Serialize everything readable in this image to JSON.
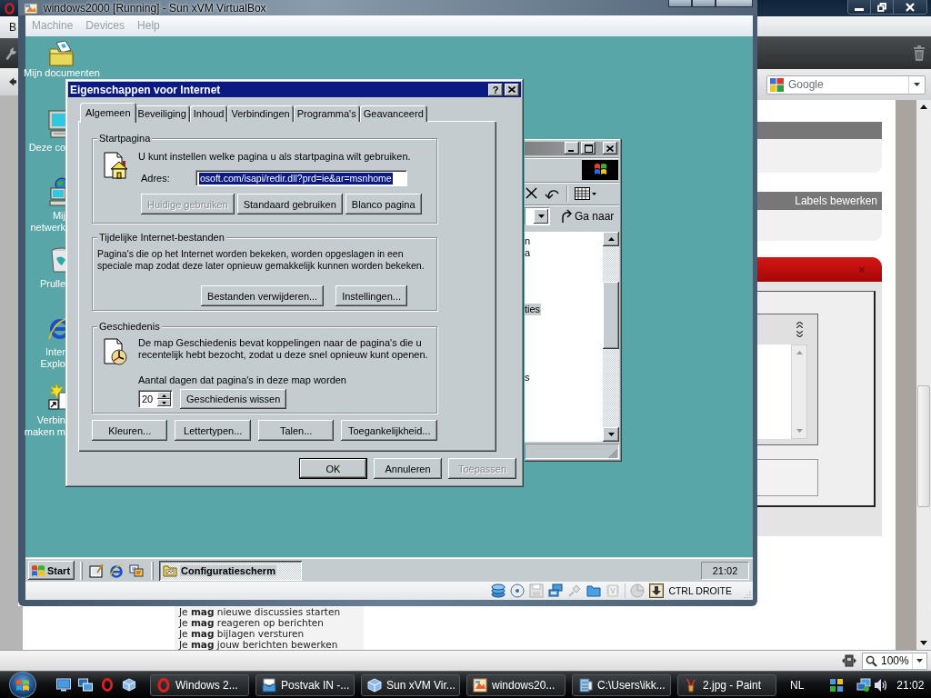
{
  "browser": {
    "tab_letter": "B",
    "search": {
      "placeholder": "Google"
    },
    "labels_link": "Labels bewerken",
    "permissions": [
      "Je **mag** nieuwe discussies starten",
      "Je **mag** reageren op berichten",
      "Je **mag** bijlagen versturen",
      "Je **mag** jouw berichten bewerken"
    ],
    "zoom": "100%"
  },
  "virtualbox": {
    "title": "windows2000 [Running] - Sun xVM VirtualBox",
    "menu": [
      {
        "label": "Machine",
        "disabled": true
      },
      {
        "label": "Devices",
        "disabled": true
      },
      {
        "label": "Help",
        "disabled": true
      }
    ],
    "host_key": "CTRL DROITE"
  },
  "guest": {
    "desktop_icons": [
      {
        "kind": "documents",
        "lines": [
          "Mijn documenten"
        ]
      },
      {
        "kind": "computer",
        "lines": [
          "Deze co"
        ]
      },
      {
        "kind": "network",
        "lines": [
          "Mij",
          "netwerk"
        ]
      },
      {
        "kind": "recycle",
        "lines": [
          "Prulle"
        ]
      },
      {
        "kind": "browser",
        "lines": [
          "Inter",
          "Explo"
        ]
      },
      {
        "kind": "connect",
        "lines": [
          "Verbin",
          "maken m"
        ]
      }
    ],
    "explorer": {
      "go_button": "Ga naar",
      "items": [
        {
          "label": "n",
          "selected": false
        },
        {
          "label": "a",
          "selected": false
        },
        {
          "label": "ties",
          "selected": true
        },
        {
          "label": "s",
          "selected": false
        }
      ]
    },
    "dialog": {
      "title": "Eigenschappen voor Internet",
      "help_label": "?",
      "tabs": [
        {
          "label": "Algemeen",
          "selected": true
        },
        {
          "label": "Beveiliging",
          "selected": false
        },
        {
          "label": "Inhoud",
          "selected": false
        },
        {
          "label": "Verbindingen",
          "selected": false
        },
        {
          "label": "Programma's",
          "selected": false
        },
        {
          "label": "Geavanceerd",
          "selected": false
        }
      ],
      "groups": [
        {
          "kind": "homepage",
          "title": "Startpagina",
          "text": "U kunt instellen welke pagina u als startpagina wilt gebruiken.",
          "address": {
            "label": "Adres:",
            "value": "osoft.com/isapi/redir.dll?prd=ie&ar=msnhome",
            "selected": true
          },
          "buttons": [
            {
              "label": "Huidige gebruiken",
              "disabled": true
            },
            {
              "label": "Standaard gebruiken",
              "disabled": false
            },
            {
              "label": "Blanco pagina",
              "disabled": false
            }
          ]
        },
        {
          "kind": "cache",
          "title": "Tijdelijke Internet-bestanden",
          "text": "Pagina's die op het Internet worden bekeken, worden opgeslagen in een speciale map zodat deze later opnieuw gemakkelijk kunnen worden bekeken.",
          "buttons": [
            {
              "label": "Bestanden verwijderen..."
            },
            {
              "label": "Instellingen..."
            }
          ]
        },
        {
          "kind": "history",
          "title": "Geschiedenis",
          "text": "De map Geschiedenis bevat koppelingen naar de pagina's die u recentelijk hebt bezocht, zodat u deze snel opnieuw kunt openen.",
          "days_label": "Aantal dagen dat pagina's in deze map worden",
          "days_value": "20",
          "buttons": [
            {
              "label": "Geschiedenis wissen"
            }
          ]
        }
      ],
      "more_buttons": [
        "Kleuren...",
        "Lettertypen...",
        "Talen...",
        "Toegankelijkheid..."
      ],
      "actions": [
        {
          "label": "OK",
          "disabled": false,
          "default": true
        },
        {
          "label": "Annuleren",
          "disabled": false,
          "default": false
        },
        {
          "label": "Toepassen",
          "disabled": true,
          "default": false
        }
      ]
    },
    "taskbar": {
      "start": "Start",
      "tasks": [
        {
          "label": "Configuratiescherm",
          "selected": true
        }
      ],
      "clock": "21:02"
    }
  },
  "taskbar": {
    "tasks": [
      {
        "kind": "ring",
        "label": "Windows 2..."
      },
      {
        "kind": "inbox",
        "label": "Postvak IN -..."
      },
      {
        "kind": "cube",
        "label": "Sun xVM Vir..."
      },
      {
        "kind": "window",
        "label": "windows20..."
      },
      {
        "kind": "cabinet",
        "label": "C:\\Users\\ikk..."
      },
      {
        "kind": "brush",
        "label": "2.jpg - Paint"
      }
    ],
    "language": "NL",
    "clock": "21:02"
  }
}
